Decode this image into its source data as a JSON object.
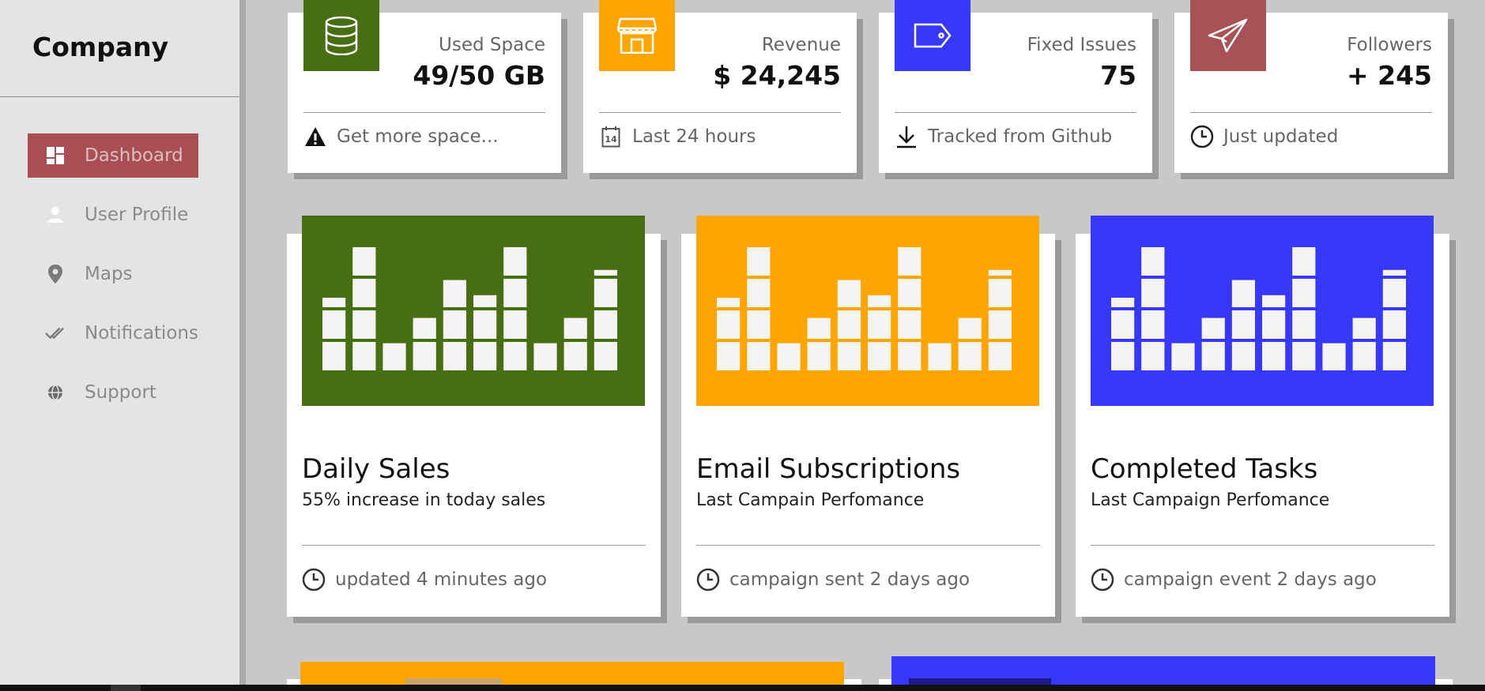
{
  "brand": "Company",
  "colors": {
    "green": "#476e10",
    "orange": "#ffa500",
    "blue": "#3838fd",
    "red": "#a85256",
    "sidebar_active": "#a94f53"
  },
  "sidebar": {
    "items": [
      {
        "label": "Dashboard",
        "icon": "dashboard-icon",
        "active": true
      },
      {
        "label": "User Profile",
        "icon": "person-icon",
        "active": false
      },
      {
        "label": "Maps",
        "icon": "location-pin-icon",
        "active": false
      },
      {
        "label": "Notifications",
        "icon": "double-check-icon",
        "active": false
      },
      {
        "label": "Support",
        "icon": "globe-icon",
        "active": false
      }
    ]
  },
  "stats": [
    {
      "category": "Used Space",
      "value": "49/50 GB",
      "footer": "Get more space...",
      "icon": "database-icon",
      "footer_icon": "warning-icon"
    },
    {
      "category": "Revenue",
      "value": "$ 24,245",
      "footer": "Last 24 hours",
      "icon": "store-icon",
      "footer_icon": "calendar-icon"
    },
    {
      "category": "Fixed Issues",
      "value": "75",
      "footer": "Tracked from Github",
      "icon": "tag-icon",
      "footer_icon": "download-icon"
    },
    {
      "category": "Followers",
      "value": "+ 245",
      "footer": "Just updated",
      "icon": "paper-plane-icon",
      "footer_icon": "clock-icon"
    }
  ],
  "cards": [
    {
      "title": "Daily Sales",
      "subtitle": "55% increase in today sales",
      "footer": "updated 4 minutes ago",
      "footer_icon": "clock-icon"
    },
    {
      "title": "Email Subscriptions",
      "subtitle": "Last Campain Perfomance",
      "footer": "campaign sent 2 days ago",
      "footer_icon": "clock-icon"
    },
    {
      "title": "Completed Tasks",
      "subtitle": "Last Campaign Perfomance",
      "footer": "campaign event 2 days ago",
      "footer_icon": "clock-icon"
    }
  ],
  "chart_data": [
    {
      "type": "bar",
      "values": [
        3,
        5,
        1.2,
        2.2,
        3.7,
        3.1,
        5,
        1.2,
        2.2,
        4.1
      ]
    },
    {
      "type": "bar",
      "values": [
        3,
        5,
        1.2,
        2.2,
        3.7,
        3.1,
        5,
        1.2,
        2.2,
        4.1
      ]
    },
    {
      "type": "bar",
      "values": [
        3,
        5,
        1.2,
        2.2,
        3.7,
        3.1,
        5,
        1.2,
        2.2,
        4.1
      ]
    }
  ]
}
